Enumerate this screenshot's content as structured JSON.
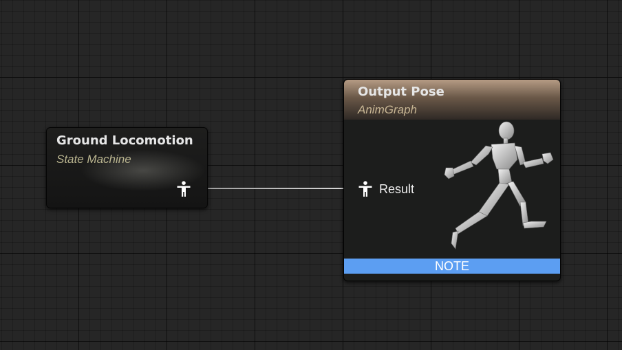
{
  "nodes": {
    "state_machine": {
      "title": "Ground Locomotion",
      "subtitle": "State Machine",
      "pin_icon": "person-pose-icon"
    },
    "output_pose": {
      "title": "Output Pose",
      "subtitle": "AnimGraph",
      "input_pin": {
        "label": "Result",
        "icon": "person-pose-icon"
      },
      "preview_icon": "running-mannequin-icon",
      "note": "NOTE",
      "note_color": "#5c9ef2"
    }
  },
  "colors": {
    "background": "#262626",
    "grid_major": "#0c0c0c",
    "subtitle_state_machine": "#b9b48f",
    "header_output_pose": "#b59b84"
  }
}
